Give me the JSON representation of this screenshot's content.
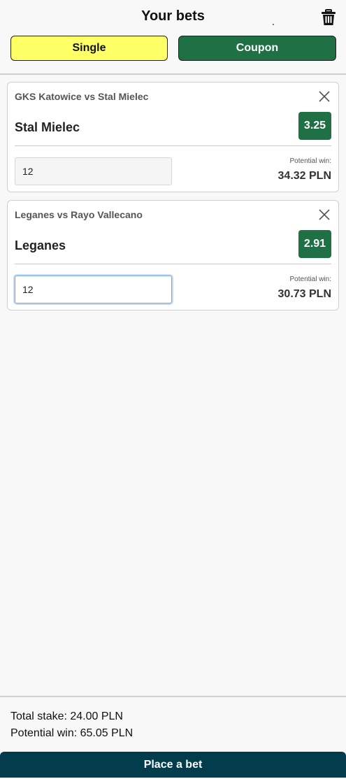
{
  "header": {
    "title": "Your bets",
    "trash_icon": "trash-icon"
  },
  "tabs": {
    "single_label": "Single",
    "coupon_label": "Coupon",
    "active": "Single"
  },
  "colors": {
    "single_tab_bg": "#ffff66",
    "coupon_tab_bg": "#1f7045",
    "odds_bg": "#1f7045",
    "place_bet_bg": "#033c4d"
  },
  "bets": [
    {
      "match": "GKS Katowice vs Stal Mielec",
      "selection": "Stal Mielec",
      "odds": "3.25",
      "stake": "12",
      "potential_win_label": "Potential win:",
      "potential_win": "34.32 PLN",
      "close_icon": "close-icon"
    },
    {
      "match": "Leganes vs Rayo Vallecano",
      "selection": "Leganes",
      "odds": "2.91",
      "stake": "12",
      "potential_win_label": "Potential win:",
      "potential_win": "30.73 PLN",
      "close_icon": "close-icon"
    }
  ],
  "summary": {
    "total_stake": "Total stake: 24.00 PLN",
    "potential_win": "Potential win: 65.05 PLN"
  },
  "place_bet_label": "Place a bet"
}
